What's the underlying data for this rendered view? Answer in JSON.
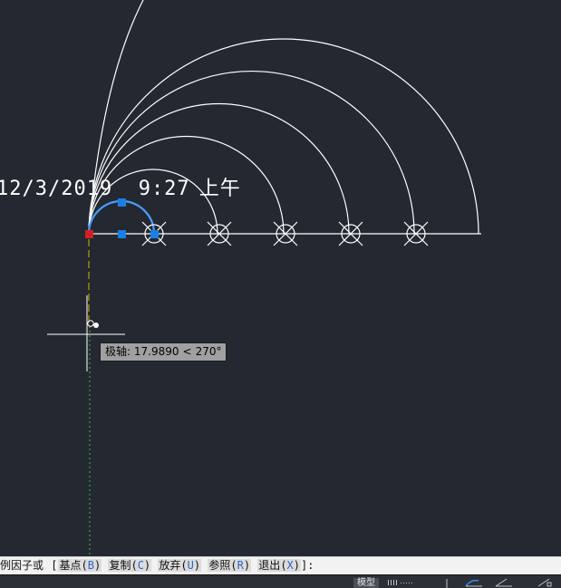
{
  "drawing": {
    "mtext_date": "12/3/2019  9:27",
    "mtext_ampm": "上午"
  },
  "tooltip": {
    "label": "极轴:",
    "distance": "17.9890",
    "symbol": "<",
    "angle": "270°"
  },
  "command_line": {
    "prefix": "例因子或",
    "open_bracket": "[",
    "options": [
      {
        "label": "基点",
        "key": "B"
      },
      {
        "label": "复制",
        "key": "C"
      },
      {
        "label": "放弃",
        "key": "U"
      },
      {
        "label": "参照",
        "key": "R"
      },
      {
        "label": "退出",
        "key": "X"
      }
    ],
    "close_bracket": "]:"
  },
  "status_bar": {
    "model_tab": "模型",
    "grid_icon": "grid-icon",
    "snap_icon": "snap-icon",
    "ortho_icon": "ortho-icon",
    "polar_icon": "polar-icon",
    "angle_icon": "angle-icon"
  },
  "colors": {
    "background": "#232831",
    "line": "#ffffff",
    "grip_blue": "#1a7fe0",
    "grip_red": "#d42020",
    "tracking_green": "#3fbf3f",
    "tracking_yellow": "#e0b000"
  }
}
